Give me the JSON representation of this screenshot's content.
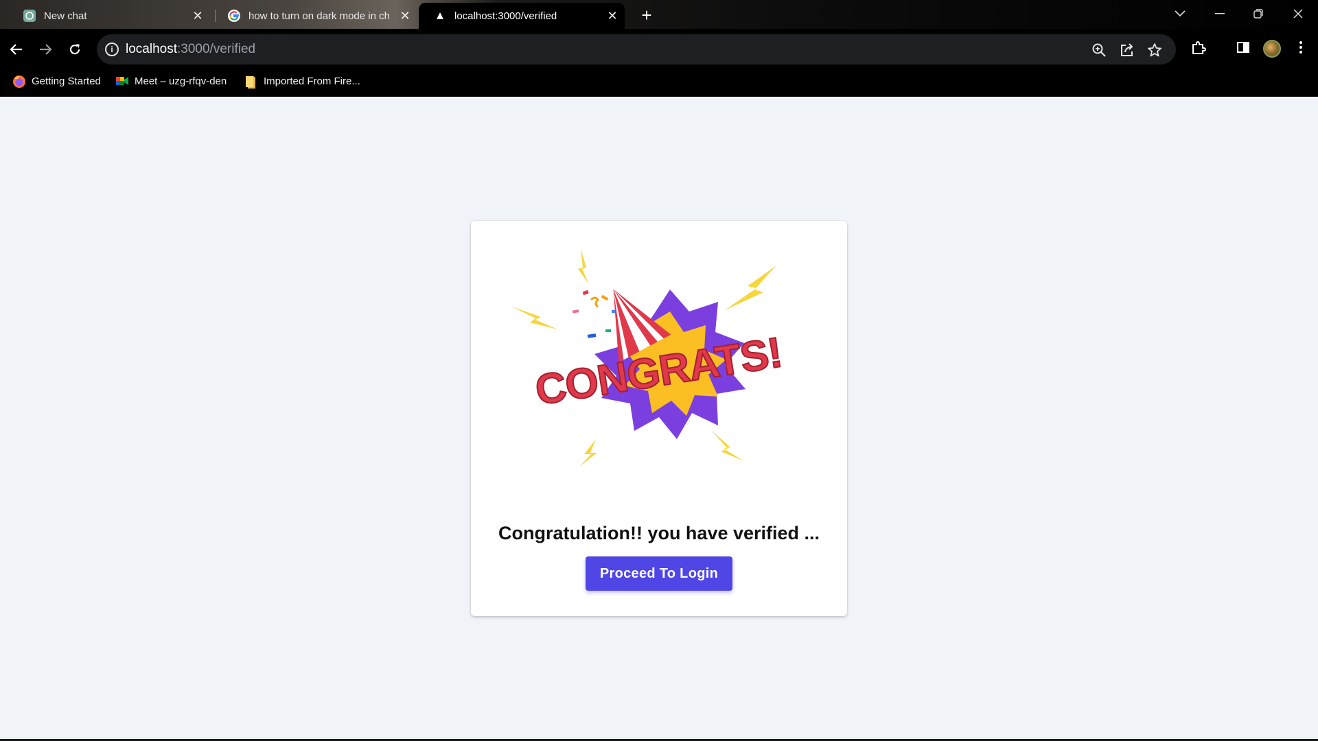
{
  "browser": {
    "tabs": [
      {
        "title": "New chat",
        "icon": "chatgpt-icon"
      },
      {
        "title": "how to turn on dark mode in ch",
        "icon": "google-icon"
      },
      {
        "title": "localhost:3000/verified",
        "icon": "triangle-icon",
        "active": true
      }
    ],
    "url_host": "localhost",
    "url_path": ":3000/verified",
    "bookmarks": [
      {
        "label": "Getting Started",
        "icon": "firefox-icon"
      },
      {
        "label": "Meet – uzg-rfqv-den",
        "icon": "google-meet-icon"
      },
      {
        "label": "Imported From Fire...",
        "icon": "folder-icon"
      }
    ]
  },
  "page": {
    "illustration_text": "CONGRATS!",
    "heading": "Congratulation!! you have verified ...",
    "button_label": "Proceed To Login",
    "colors": {
      "background": "#f0f3f8",
      "card": "#ffffff",
      "button": "#4f46e5",
      "burst_purple": "#7b3fe0",
      "burst_yellow": "#fbbf24",
      "text_red": "#e0394b",
      "lightning": "#f5d63d"
    }
  }
}
